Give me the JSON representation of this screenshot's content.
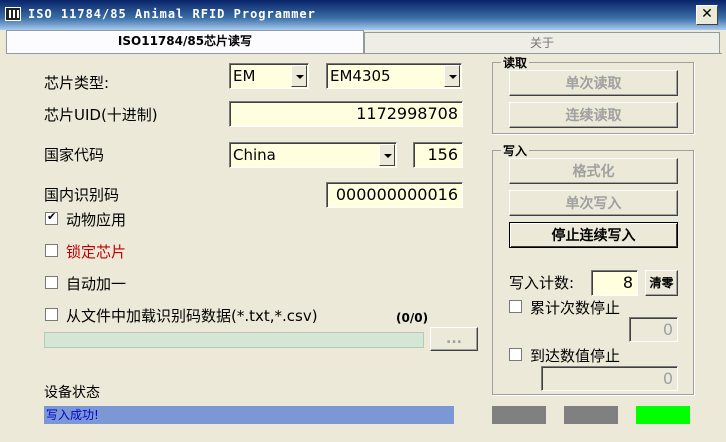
{
  "window": {
    "title": "ISO 11784/85 Animal RFID Programmer",
    "close": "✕"
  },
  "tabs": [
    {
      "label": "ISO11784/85芯片读写"
    },
    {
      "label": "关于"
    }
  ],
  "form": {
    "chip_type_label": "芯片类型:",
    "chip_type_1": "EM",
    "chip_type_2": "EM4305",
    "chip_uid_label": "芯片UID(十进制)",
    "chip_uid": "1172998708",
    "country_label": "国家代码",
    "country_name": "China",
    "country_code": "156",
    "national_id_label": "国内识别码",
    "national_id": "000000000016",
    "animal_app_label": "动物应用",
    "animal_app_checked": true,
    "lock_chip_label": "锁定芯片",
    "lock_chip_checked": false,
    "auto_inc_label": "自动加一",
    "auto_inc_checked": false,
    "load_file_label": "从文件中加载识别码数据(*.txt,*.csv)",
    "load_file_checked": false,
    "file_progress": "(0/0)",
    "browse_label": "..."
  },
  "read_group": {
    "title": "读取",
    "single_read": "单次读取",
    "continuous_read": "连续读取"
  },
  "write_group": {
    "title": "写入",
    "format": "格式化",
    "single_write": "单次写入",
    "stop_continuous_write": "停止连续写入",
    "write_count_label": "写入计数:",
    "write_count": "8",
    "clear": "清零",
    "stop_on_count_label": "累计次数停止",
    "stop_on_count_value": "0",
    "stop_on_value_label": "到达数值停止",
    "stop_on_value_value": "0"
  },
  "device": {
    "status_label": "设备状态",
    "status_text": "写入成功!",
    "lamp_colors": [
      "#808080",
      "#808080",
      "#00ff00"
    ]
  }
}
